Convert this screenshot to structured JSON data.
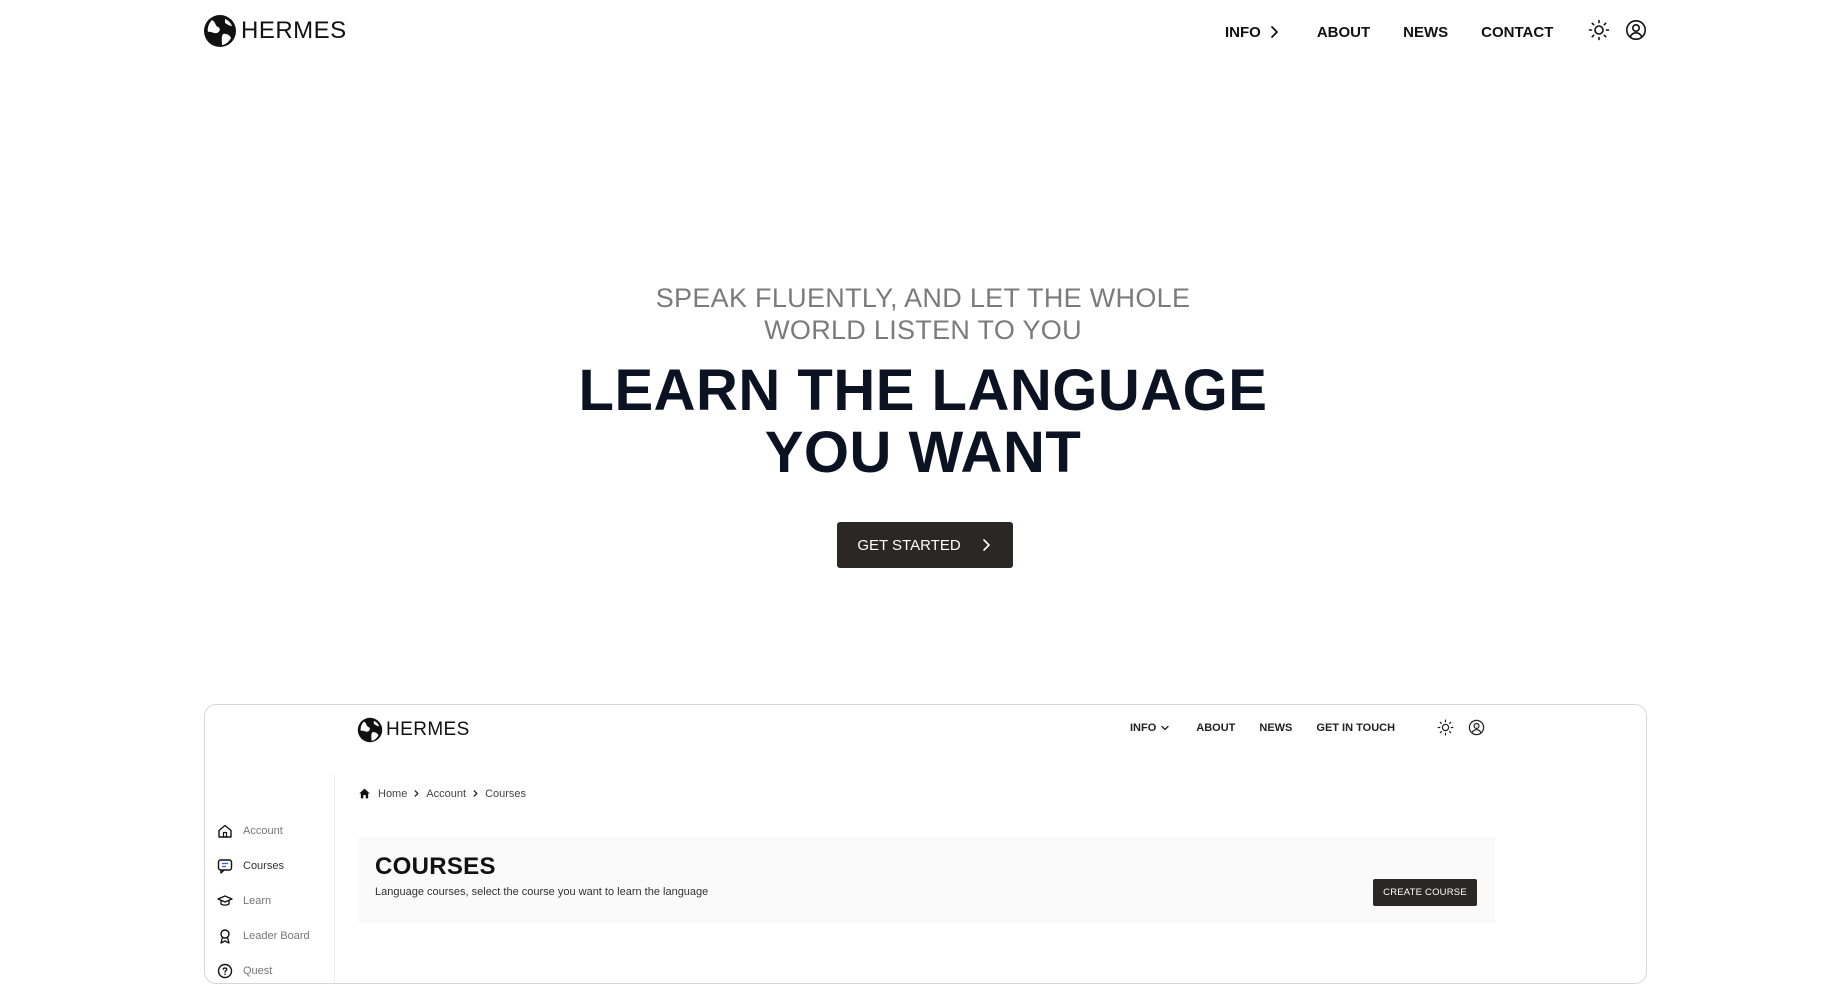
{
  "header": {
    "brand": "HERMES",
    "nav": {
      "info": "INFO",
      "about": "ABOUT",
      "news": "NEWS",
      "contact": "CONTACT"
    },
    "icons": [
      "globe-logo-icon",
      "sun-icon",
      "user-circle-icon",
      "chevron-right-icon"
    ]
  },
  "hero": {
    "tagline": "SPEAK FLUENTLY, AND LET THE WHOLE WORLD LISTEN TO YOU",
    "headline": "LEARN THE LANGUAGE YOU WANT",
    "cta_label": "GET STARTED"
  },
  "preview": {
    "brand": "HERMES",
    "nav": {
      "info": "INFO",
      "about": "ABOUT",
      "news": "NEWS",
      "touch": "GET IN TOUCH"
    },
    "sidebar": {
      "items": [
        {
          "label": "Account",
          "icon": "home-icon"
        },
        {
          "label": "Courses",
          "icon": "chat-icon"
        },
        {
          "label": "Learn",
          "icon": "graduation-cap-icon"
        },
        {
          "label": "Leader Board",
          "icon": "award-icon"
        },
        {
          "label": "Quest",
          "icon": "question-circle-icon"
        }
      ],
      "active": "Courses"
    },
    "breadcrumb": [
      "Home",
      "Account",
      "Courses"
    ],
    "card": {
      "title": "COURSES",
      "description": "Language courses, select the course you want to learn the language",
      "button_label": "CREATE COURSE"
    }
  },
  "colors": {
    "background": "#ffffff",
    "text_dark": "#0b1222",
    "tagline_gray": "#7b7b7b",
    "button_dark": "#2a2726",
    "card_bg": "#fafafa",
    "frame_border": "#d6d6d6"
  }
}
